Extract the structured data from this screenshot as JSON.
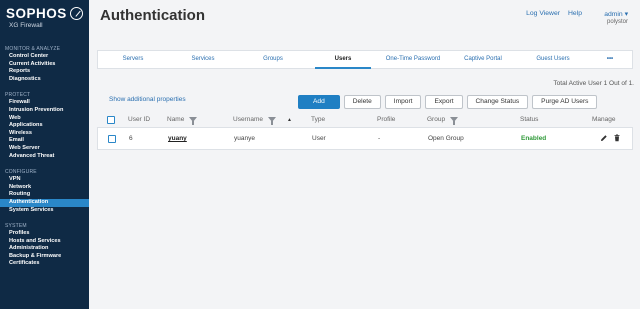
{
  "brand": {
    "name": "SOPHOS",
    "product": "XG Firewall"
  },
  "sidebar": {
    "groups": [
      {
        "heading": "MONITOR & ANALYZE",
        "items": [
          "Control Center",
          "Current Activities",
          "Reports",
          "Diagnostics"
        ]
      },
      {
        "heading": "PROTECT",
        "items": [
          "Firewall",
          "Intrusion Prevention",
          "Web",
          "Applications",
          "Wireless",
          "Email",
          "Web Server",
          "Advanced Threat"
        ]
      },
      {
        "heading": "CONFIGURE",
        "items": [
          "VPN",
          "Network",
          "Routing",
          "Authentication",
          "System Services"
        ]
      },
      {
        "heading": "SYSTEM",
        "items": [
          "Profiles",
          "Hosts and Services",
          "Administration",
          "Backup & Firmware",
          "Certificates"
        ]
      }
    ],
    "active": "Authentication"
  },
  "header": {
    "title": "Authentication",
    "log_viewer": "Log Viewer",
    "help": "Help",
    "admin": "admin ▾",
    "device": "polystor"
  },
  "tabs": {
    "items": [
      "Servers",
      "Services",
      "Groups",
      "Users",
      "One-Time Password",
      "Captive Portal",
      "Guest Users"
    ],
    "active": "Users",
    "more": "•••"
  },
  "summary": "Total Active User 1 Out of 1.",
  "show_props": "Show additional properties",
  "actions": {
    "add": "Add",
    "delete": "Delete",
    "import": "Import",
    "export": "Export",
    "change_status": "Change Status",
    "purge_ad": "Purge AD Users"
  },
  "table": {
    "columns": {
      "user_id": "User ID",
      "name": "Name",
      "username": "Username",
      "type": "Type",
      "profile": "Profile",
      "group": "Group",
      "status": "Status",
      "manage": "Manage"
    },
    "rows": [
      {
        "user_id": "6",
        "name": "yuany",
        "username": "yuanye",
        "type": "User",
        "profile": "-",
        "group": "Open Group",
        "status": "Enabled"
      }
    ]
  },
  "colors": {
    "sidebar": "#0f2a45",
    "accent": "#1f7fc3",
    "enabled": "#2f9a39"
  },
  "icons": {
    "edit": "pencil-icon",
    "delete": "trash-icon"
  }
}
